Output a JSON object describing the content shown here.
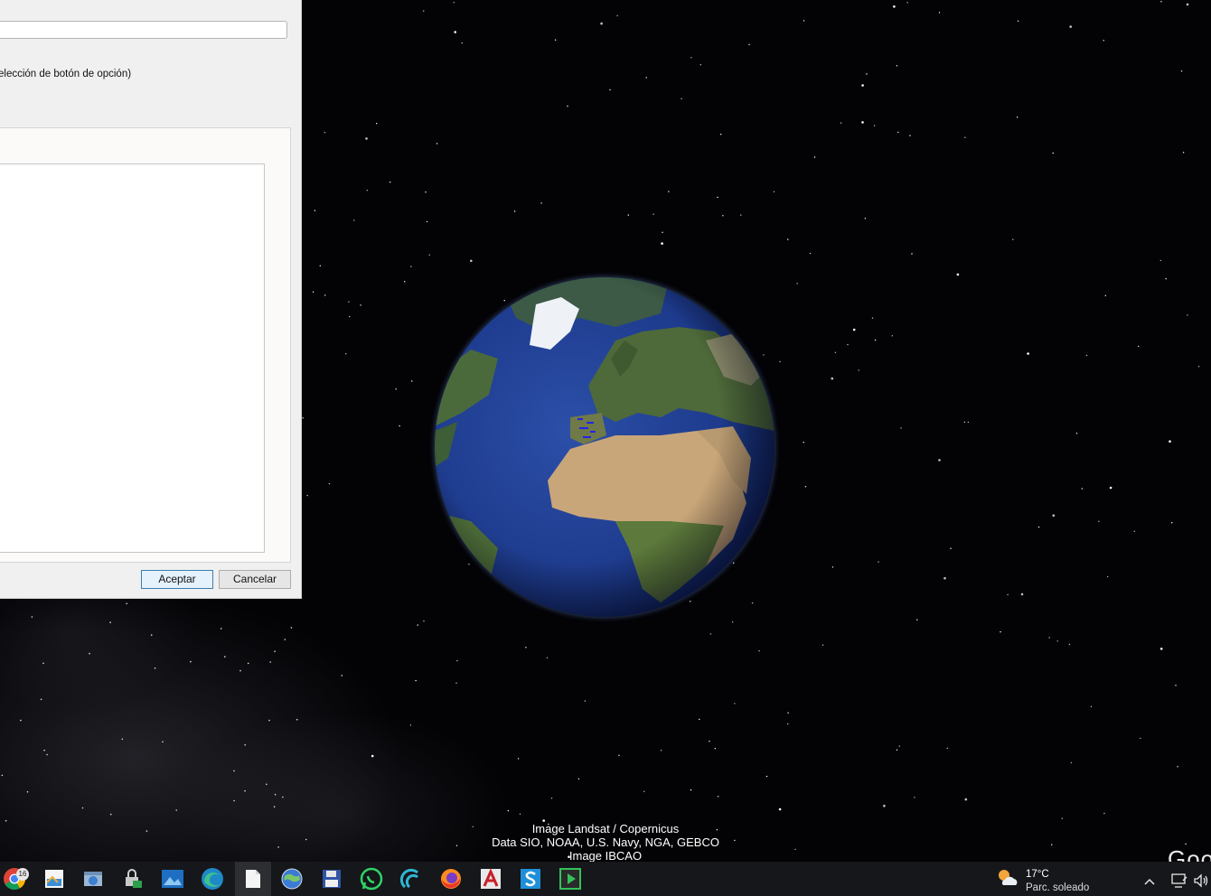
{
  "dialog": {
    "hint_text": "elección de botón de opción)",
    "ok_label": "Aceptar",
    "cancel_label": "Cancelar"
  },
  "map": {
    "attribution": [
      "Image Landsat / Copernicus",
      "Data SIO, NOAA, U.S. Navy, NGA, GEBCO",
      "Image IBCAO"
    ],
    "logo_fragment": "Goo"
  },
  "taskbar": {
    "apps": [
      {
        "name": "chrome-icon",
        "badge": "16"
      },
      {
        "name": "photo-viewer-icon"
      },
      {
        "name": "control-panel-icon"
      },
      {
        "name": "network-lock-icon"
      },
      {
        "name": "photos-icon"
      },
      {
        "name": "edge-icon"
      },
      {
        "name": "document-icon"
      },
      {
        "name": "google-earth-icon"
      },
      {
        "name": "save-disk-icon"
      },
      {
        "name": "whatsapp-icon"
      },
      {
        "name": "wave-app-icon"
      },
      {
        "name": "firefox-icon"
      },
      {
        "name": "acrobat-icon"
      },
      {
        "name": "s-app-icon"
      },
      {
        "name": "media-player-icon"
      }
    ],
    "chrome_badge": "16",
    "weather": {
      "temp": "17°C",
      "desc": "Parc. soleado"
    }
  },
  "colors": {
    "taskbar_bg": "#16171a",
    "dialog_bg": "#f0f0f0",
    "ok_border": "#3c7fb1"
  }
}
